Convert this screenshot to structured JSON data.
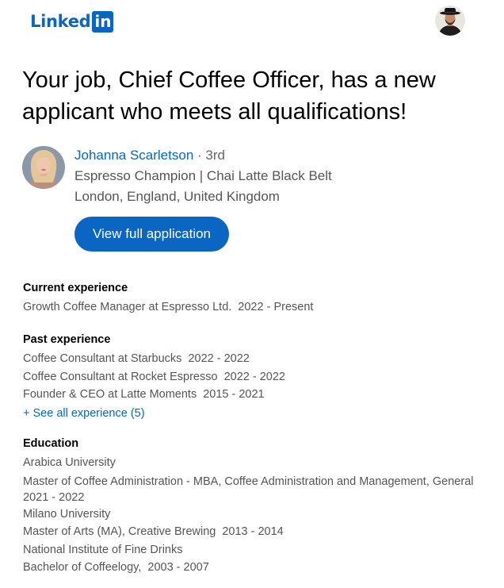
{
  "brand": {
    "logo_text": "Linked",
    "logo_box": "in"
  },
  "colors": {
    "accent": "#0a66c2",
    "muted_text": "#555555"
  },
  "headline": "Your job, Chief Coffee Officer, has a new applicant who meets all qualifications!",
  "candidate": {
    "name": "Johanna Scarletson",
    "degree": " · 3rd",
    "title": "Espresso Champion | Chai Latte Black Belt",
    "location": "London, England, United Kingdom"
  },
  "view_button_label": "View full application",
  "current_experience": {
    "title": "Current experience",
    "items": [
      {
        "role": "Growth Coffee Manager at Espresso Ltd.",
        "dates": "2022 - Present"
      }
    ]
  },
  "past_experience": {
    "title": "Past experience",
    "items": [
      {
        "role": "Coffee Consultant at Starbucks",
        "dates": "2022 - 2022"
      },
      {
        "role": "Coffee Consultant at Rocket Espresso",
        "dates": "2022 - 2022"
      },
      {
        "role": "Founder & CEO at Latte Moments",
        "dates": "2015 - 2021"
      }
    ],
    "see_all_label": "+ See all experience (5)"
  },
  "education": {
    "title": "Education",
    "items": [
      {
        "school": "Arabica University",
        "degree": "Master of Coffee Administration - MBA, Coffee Administration and Management, General",
        "dates": "2021 - 2022"
      },
      {
        "school": "Milano University",
        "degree": "Master of Arts (MA), Creative Brewing",
        "dates": "2013 - 2014"
      },
      {
        "school": "National Institute of Fine Drinks",
        "degree": "Bachelor of Coffeelogy,",
        "dates": "2003 - 2007"
      }
    ]
  }
}
